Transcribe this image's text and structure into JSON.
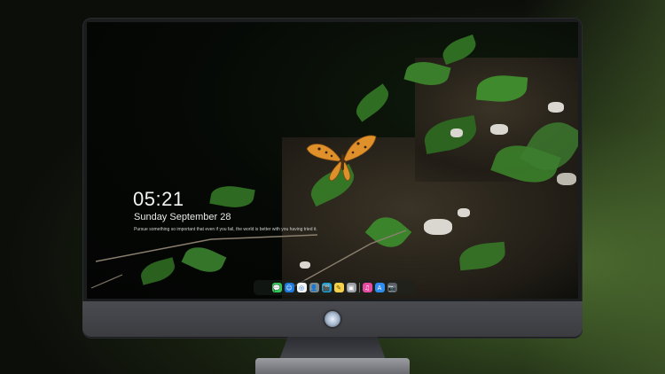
{
  "lockscreen": {
    "time": "05:21",
    "date": "Sunday September  28",
    "quote": "Pursue something so important that even if you fail, the world is better with you having tried it."
  },
  "dock": {
    "apps": [
      {
        "name": "messages",
        "glyph": "💬",
        "color": "#34c759"
      },
      {
        "name": "finder",
        "glyph": "☺",
        "color": "#1f7ae0"
      },
      {
        "name": "safari",
        "glyph": "◎",
        "color": "#f4f4f4"
      },
      {
        "name": "contacts",
        "glyph": "👤",
        "color": "#7f8c8d"
      },
      {
        "name": "movie-clapper",
        "glyph": "🎬",
        "color": "#1aa3d9"
      },
      {
        "name": "notes",
        "glyph": "✎",
        "color": "#f5d04a"
      },
      {
        "name": "photos",
        "glyph": "▣",
        "color": "#9aa0a6"
      },
      {
        "name": "itunes",
        "glyph": "♫",
        "color": "#e94aa1"
      },
      {
        "name": "app-store",
        "glyph": "A",
        "color": "#2f8cf0"
      },
      {
        "name": "camera",
        "glyph": "📷",
        "color": "#5b5f66"
      }
    ]
  },
  "colors": {
    "leaf": "#2f6d22",
    "butterfly": "#e0902a",
    "bezel": "#1b1c1e"
  }
}
